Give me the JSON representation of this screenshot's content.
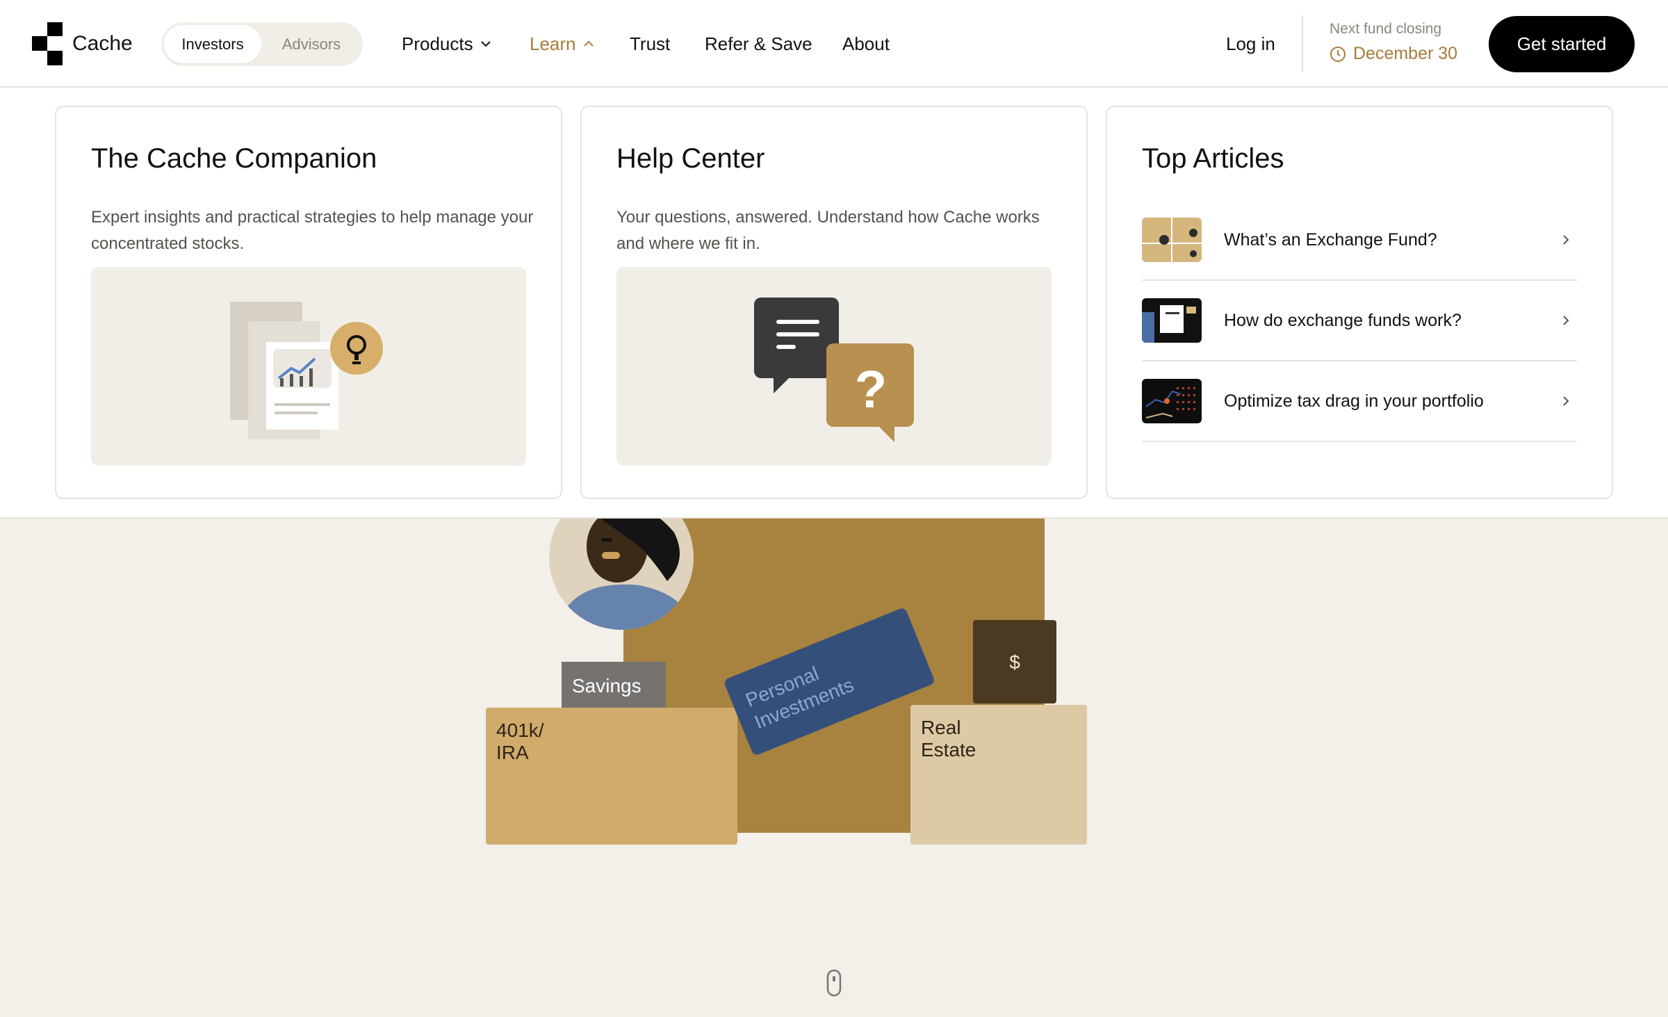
{
  "brand": {
    "name": "Cache"
  },
  "audience_toggle": {
    "options": [
      "Investors",
      "Advisors"
    ],
    "selected": "Investors"
  },
  "nav": {
    "products": "Products",
    "learn": "Learn",
    "trust": "Trust",
    "refer": "Refer & Save",
    "about": "About"
  },
  "header": {
    "login": "Log in",
    "closing_label": "Next fund closing",
    "closing_date": "December 30",
    "cta": "Get started"
  },
  "learn_menu": {
    "companion": {
      "title": "The Cache Companion",
      "description": "Expert insights and practical strategies to help manage your concentrated stocks."
    },
    "help": {
      "title": "Help Center",
      "description": "Your questions, answered. Understand how Cache works and where we fit in."
    },
    "top_articles": {
      "title": "Top Articles",
      "items": [
        {
          "title": "What’s an Exchange Fund?"
        },
        {
          "title": "How do exchange funds work?"
        },
        {
          "title": "Optimize tax drag in your portfolio"
        }
      ]
    }
  },
  "hero": {
    "labels": {
      "savings": "Savings",
      "ira_line1": "401k/",
      "ira_line2": "IRA",
      "personal_line1": "Personal",
      "personal_line2": "Investments",
      "real_line1": "Real",
      "real_line2": "Estate",
      "dollar": "$"
    }
  },
  "colors": {
    "accent_gold": "#a67c3b",
    "box_brown": "#a8823f",
    "box_tan": "#d1ab6b",
    "box_light": "#ddc9a4",
    "navy_card": "#34507a",
    "dark_box": "#4a3a22",
    "background": "#f3f0ea"
  }
}
